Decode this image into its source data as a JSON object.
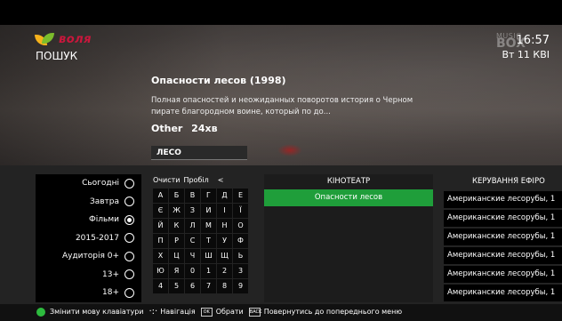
{
  "header": {
    "logo_text": "воля",
    "page_title": "ПОШУК",
    "time": "16:57",
    "date": "Вт 11 КВІ",
    "channel_watermark": [
      "MUSIC",
      "BOX"
    ]
  },
  "movie": {
    "title": "Опасности лесов  (1998)",
    "description": "Полная опасностей и неожиданных поворотов история о Черном пирате  благородном воине, который по до...",
    "genre": "Other",
    "duration": "24хв"
  },
  "search": {
    "value": "ЛЕСО"
  },
  "filters": [
    {
      "label": "Сьогодні",
      "selected": false
    },
    {
      "label": "Завтра",
      "selected": false
    },
    {
      "label": "Фільми",
      "selected": true
    },
    {
      "label": "2015-2017",
      "selected": false
    },
    {
      "label": "Аудиторія 0+",
      "selected": false
    },
    {
      "label": "13+",
      "selected": false
    },
    {
      "label": "18+",
      "selected": false
    }
  ],
  "keyboard": {
    "clear": "Очисти",
    "space": "Пробіл",
    "backspace": "<",
    "rows": [
      [
        "А",
        "Б",
        "В",
        "Г",
        "Д",
        "Е"
      ],
      [
        "Є",
        "Ж",
        "З",
        "И",
        "І",
        "Ї"
      ],
      [
        "Й",
        "К",
        "Л",
        "М",
        "Н",
        "О"
      ],
      [
        "П",
        "Р",
        "С",
        "Т",
        "У",
        "Ф"
      ],
      [
        "Х",
        "Ц",
        "Ч",
        "Ш",
        "Щ",
        "Ь"
      ],
      [
        "Ю",
        "Я",
        "0",
        "1",
        "2",
        "3"
      ],
      [
        "4",
        "5",
        "6",
        "7",
        "8",
        "9"
      ]
    ]
  },
  "cinema": {
    "header": "КІНОТЕАТР",
    "results": [
      "Опасности лесов"
    ]
  },
  "epg": {
    "header": "КЕРУВАННЯ ЕФІРО",
    "results": [
      "Американские лесорубы, 1",
      "Американские лесорубы, 1",
      "Американские лесорубы, 1",
      "Американские лесорубы, 1",
      "Американские лесорубы, 1",
      "Американские лесорубы, 1"
    ]
  },
  "legend": {
    "change_layout": "Змінити мову клавіатури",
    "navigation": "Навігація",
    "ok_label": "Обрати",
    "back_label": "Повернутись до попереднього меню",
    "ok_icon_text": "OK",
    "back_icon_text": "BACK"
  },
  "colors": {
    "accent_green": "#1f9e3a",
    "logo_red": "#c9173c",
    "legend_green": "#2dbb3e"
  }
}
